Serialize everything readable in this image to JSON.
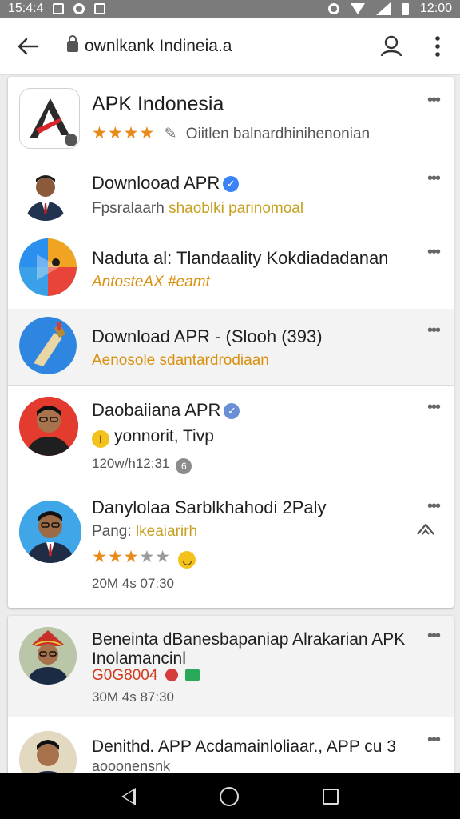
{
  "status_bar": {
    "time_left": "15:4:4",
    "time_right": "12:00"
  },
  "address_bar": {
    "url": "ownlkank Indineia.a"
  },
  "results": [
    {
      "title": "APK Indonesia",
      "subtitle": "Oiitlen balnardhinihenonian",
      "rating": 4
    },
    {
      "title": "Downlooad APR",
      "subtitle_a": "Fpsralaarh",
      "subtitle_b": "shaoblki parinomoal"
    },
    {
      "title": "Naduta al: Tlandaality Kokdiadadanan",
      "subtitle": "AntosteAX #eamt"
    },
    {
      "title": "Download APR - (Slooh (393)",
      "subtitle": "Aenosole sdantardrodiaan"
    },
    {
      "title": "Daobaiiana APR",
      "subtitle": "yonnorit, Tivp",
      "meta": "120w/h12:31"
    },
    {
      "title": "Danylolaa Sarblkhahodi 2Paly",
      "subtitle_a": "Pang:",
      "subtitle_b": "lkeaiarirh",
      "rating": 3,
      "meta": "20M 4s 07:30"
    },
    {
      "title": "Beneinta dBanesbapaniap Alrakarian APK",
      "title_line2": "Inolamancinl",
      "subtitle": "G0G8004",
      "meta": "30M 4s 87:30"
    },
    {
      "title": "Denithd. APP Acdamainloliaar., APP cu 3",
      "subtitle": "aooonensnk"
    }
  ],
  "more_label": "•••"
}
